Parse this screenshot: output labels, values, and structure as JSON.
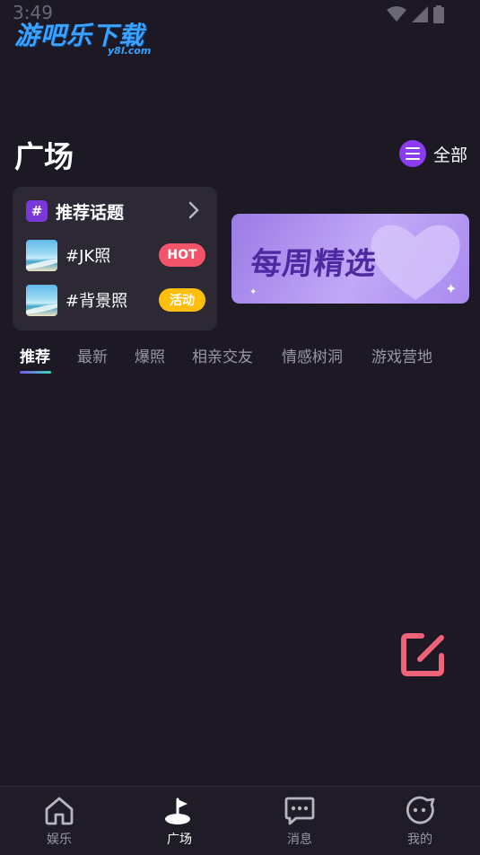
{
  "status": {
    "time": "3:49"
  },
  "watermark": {
    "main": "游吧乐下载",
    "sub": "y8l.com"
  },
  "header": {
    "title": "广场",
    "all_label": "全部"
  },
  "topics": {
    "title": "推荐话题",
    "badge": "#",
    "items": [
      {
        "name": "#JK照",
        "tag": "HOT"
      },
      {
        "name": "#背景照",
        "tag": "活动"
      }
    ]
  },
  "banner": {
    "text": "每周精选"
  },
  "tabs": [
    {
      "label": "推荐",
      "active": true
    },
    {
      "label": "最新"
    },
    {
      "label": "爆照"
    },
    {
      "label": "相亲交友"
    },
    {
      "label": "情感树洞"
    },
    {
      "label": "游戏营地"
    }
  ],
  "bottom_nav": [
    {
      "label": "娱乐",
      "icon": "home-icon"
    },
    {
      "label": "广场",
      "icon": "golf-flag-icon",
      "active": true
    },
    {
      "label": "消息",
      "icon": "chat-bubble-icon"
    },
    {
      "label": "我的",
      "icon": "face-icon"
    }
  ],
  "colors": {
    "background": "#1c1924",
    "card": "#2c2935",
    "accent_purple": "#8a3cf2",
    "hot_tag": "#f4546a",
    "activity_tag": "#ffbe0a",
    "fab": "#f06277"
  }
}
